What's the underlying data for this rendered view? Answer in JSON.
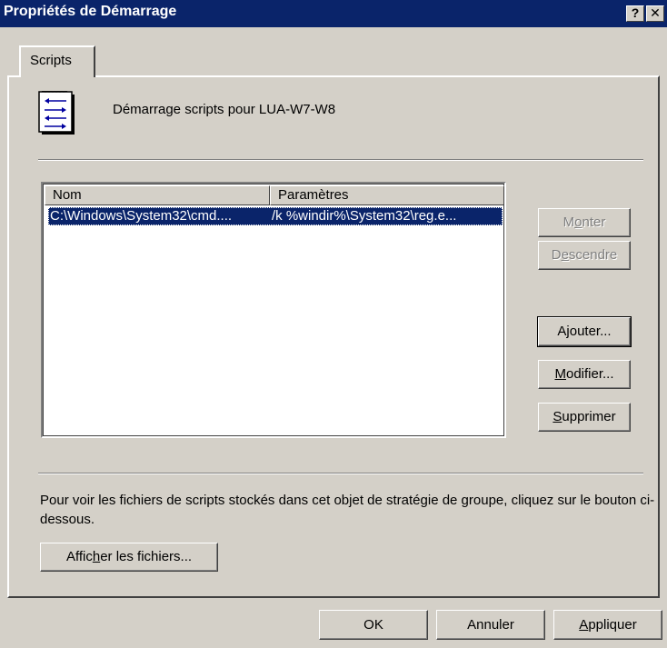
{
  "window": {
    "title": "Propriétés de Démarrage",
    "help_glyph": "?",
    "close_glyph": "✕"
  },
  "tabs": [
    {
      "label": "Scripts",
      "selected": true
    }
  ],
  "header": {
    "icon": "script-file-icon",
    "text": "Démarrage scripts pour LUA-W7-W8"
  },
  "list": {
    "columns": [
      "Nom",
      "Paramètres"
    ],
    "rows": [
      {
        "nom": "C:\\Windows\\System32\\cmd....",
        "param": "/k %windir%\\System32\\reg.e...",
        "selected": true
      }
    ]
  },
  "side_buttons": {
    "monter": {
      "pre": "M",
      "acc": "o",
      "post": "nter",
      "enabled": false
    },
    "descendre": {
      "pre": "D",
      "acc": "e",
      "post": "scendre",
      "enabled": false
    },
    "ajouter": {
      "label": "Ajouter...",
      "enabled": true
    },
    "modifier": {
      "pre": "",
      "acc": "M",
      "post": "odifier...",
      "enabled": true
    },
    "supprimer": {
      "pre": "",
      "acc": "S",
      "post": "upprimer",
      "enabled": true
    }
  },
  "info_text": "Pour voir les fichiers de scripts stockés dans cet objet de stratégie de groupe, cliquez sur le bouton ci-dessous.",
  "show_files": {
    "pre": "Affic",
    "acc": "h",
    "post": "er les fichiers..."
  },
  "dialog_buttons": {
    "ok": "OK",
    "cancel": "Annuler",
    "apply": {
      "pre": "",
      "acc": "A",
      "post": "ppliquer"
    }
  }
}
